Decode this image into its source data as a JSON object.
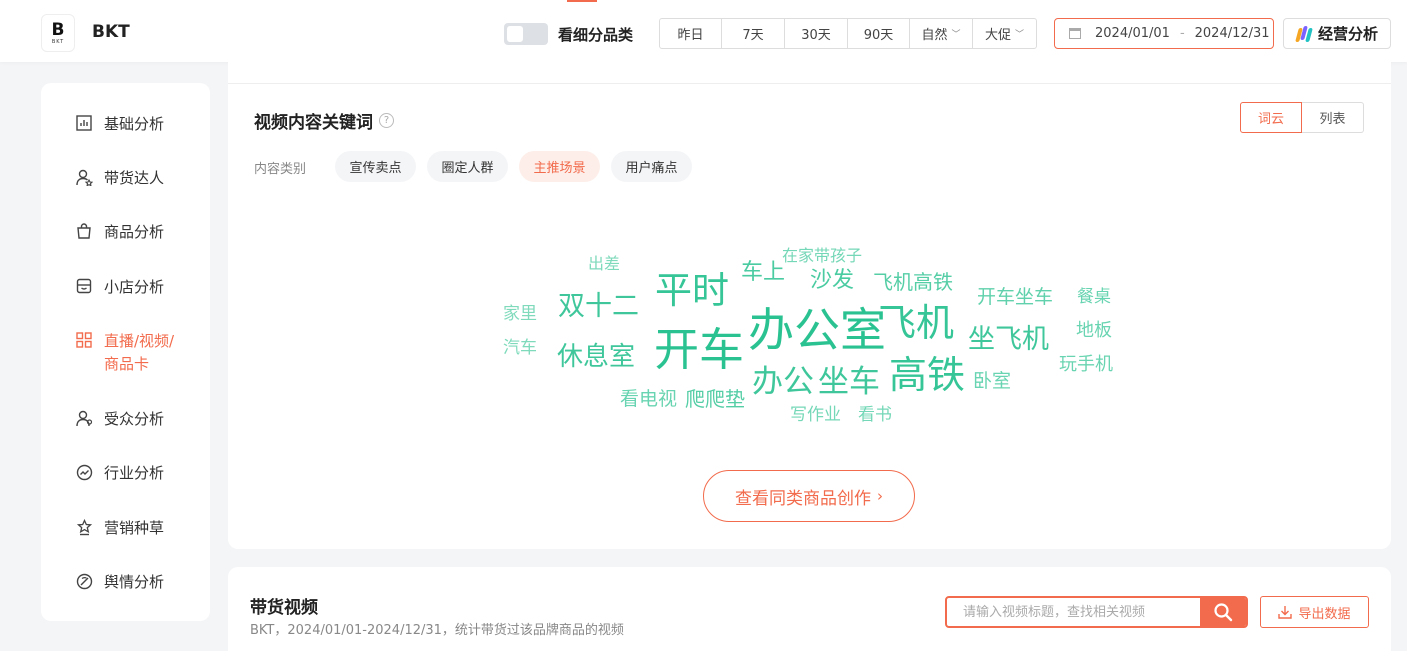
{
  "header": {
    "logo_letter": "B",
    "logo_sub": "BKT",
    "brand_name": "BKT",
    "toggle_label": "看细分品类",
    "ranges": [
      "昨日",
      "7天",
      "30天",
      "90天"
    ],
    "filter_natural": "自然",
    "filter_promo": "大促",
    "date_start": "2024/01/01",
    "date_sep": "-",
    "date_end": "2024/12/31",
    "biz_label": "经营分析"
  },
  "sidebar": {
    "items": [
      {
        "label": "基础分析",
        "icon": "bar-chart-icon"
      },
      {
        "label": "带货达人",
        "icon": "user-star-icon"
      },
      {
        "label": "商品分析",
        "icon": "shopping-bag-icon"
      },
      {
        "label": "小店分析",
        "icon": "store-icon"
      },
      {
        "label": "直播/视频/商品卡",
        "icon": "grid-icon",
        "active": true
      },
      {
        "label": "受众分析",
        "icon": "audience-icon"
      },
      {
        "label": "行业分析",
        "icon": "trend-icon"
      },
      {
        "label": "营销种草",
        "icon": "sprout-icon"
      },
      {
        "label": "舆情分析",
        "icon": "sentiment-icon"
      }
    ]
  },
  "keywords": {
    "title": "视频内容关键词",
    "view_cloud": "词云",
    "view_list": "列表",
    "category_label": "内容类别",
    "chips": [
      "宣传卖点",
      "圈定人群",
      "主推场景",
      "用户痛点"
    ],
    "active_chip": "主推场景",
    "words": [
      "在家带孩子",
      "出差",
      "车上",
      "平时",
      "沙发",
      "飞机高铁",
      "开车坐车",
      "餐桌",
      "双十二",
      "家里",
      "飞机",
      "办公室",
      "坐飞机",
      "地板",
      "开车",
      "汽车",
      "休息室",
      "高铁",
      "玩手机",
      "办公",
      "坐车",
      "卧室",
      "看电视",
      "爬爬垫",
      "写作业",
      "看书"
    ],
    "more_button": "查看同类商品创作"
  },
  "videos": {
    "title": "带货视频",
    "subtitle": "BKT，2024/01/01-2024/12/31，统计带货过该品牌商品的视频",
    "search_placeholder": "请输入视频标题，查找相关视频",
    "search_value": "",
    "export_label": "导出数据"
  },
  "colors": {
    "accent": "#f26b4c",
    "cloud_green": "#2bc291"
  }
}
